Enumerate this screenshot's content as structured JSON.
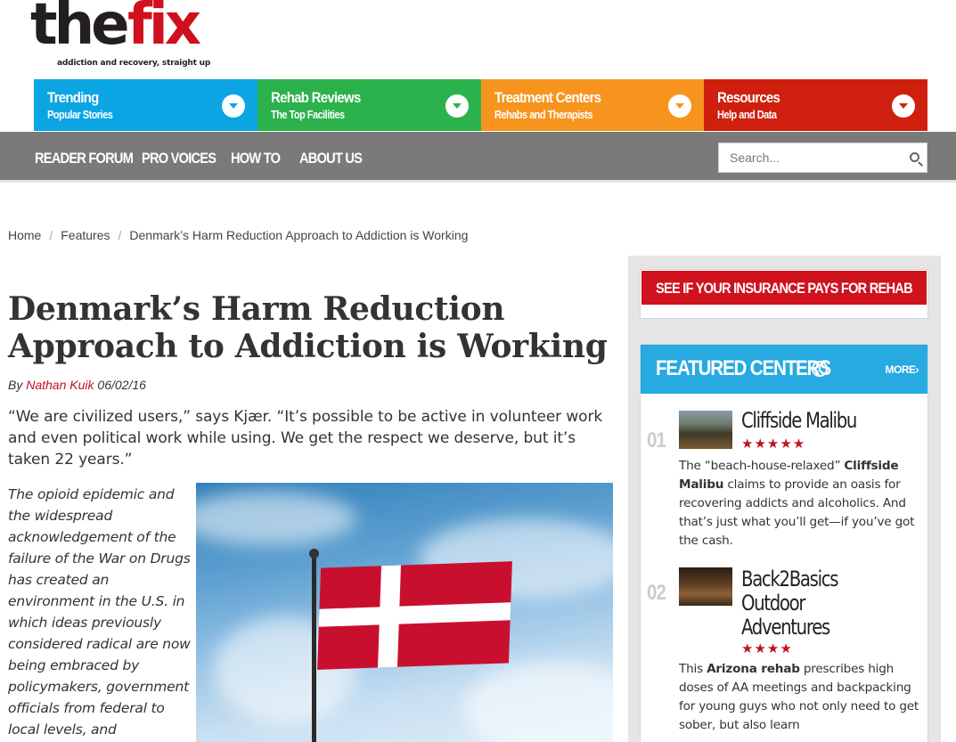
{
  "logo": {
    "word1": "the",
    "word2": "fix",
    "tagline": "addiction and recovery, straight up"
  },
  "categories": [
    {
      "title": "Trending",
      "subtitle": "Popular Stories",
      "color": "#0aa5e2"
    },
    {
      "title": "Rehab Reviews",
      "subtitle": "The Top Facilities",
      "color": "#2bb24c"
    },
    {
      "title": "Treatment Centers",
      "subtitle": "Rehabs and Therapists",
      "color": "#f7941d"
    },
    {
      "title": "Resources",
      "subtitle": "Help and Data",
      "color": "#cf1f0f"
    }
  ],
  "nav": {
    "items": [
      "READER FORUM",
      "PRO VOICES",
      "HOW TO",
      "ABOUT US"
    ]
  },
  "search": {
    "placeholder": "Search..."
  },
  "breadcrumb": [
    "Home",
    "Features",
    "Denmark’s Harm Reduction Approach to Addiction is Working"
  ],
  "article": {
    "title": "Denmark’s Harm Reduction Approach to Addiction is Working",
    "by": "By",
    "author": "Nathan Kuik",
    "date": "06/02/16",
    "pullquote": "“We are civilized users,” says Kjær. “It’s possible to be active in volunteer work and even political work while using. We get the respect we deserve, but it’s taken 22 years.”",
    "lede": "The opioid epidemic and the widespread acknowledgement of the failure of the War on Drugs has created an environment in the U.S. in which ideas previously considered radical are now being embraced by policymakers, government officials from federal to local levels, and"
  },
  "sidebar": {
    "insurance_cta": "SEE IF YOUR INSURANCE PAYS FOR REHAB",
    "featured": {
      "title": "FEATURED CENTERS",
      "info": "i",
      "more": "MORE›",
      "centers": [
        {
          "num": "01",
          "name": "Cliffside Malibu",
          "rating": 5,
          "desc_parts": [
            "The “beach-house-relaxed” ",
            "Cliffside Malibu",
            " claims to provide an oasis for recovering addicts and alcoholics. And that’s just what you’ll get—if you’ve got the cash."
          ]
        },
        {
          "num": "02",
          "name": "Back2Basics Outdoor Adventures",
          "rating": 4,
          "desc_parts": [
            "This ",
            "Arizona rehab",
            " prescribes high doses of AA meetings and backpacking for young guys who not only need to get sober, but also learn"
          ]
        }
      ]
    }
  }
}
